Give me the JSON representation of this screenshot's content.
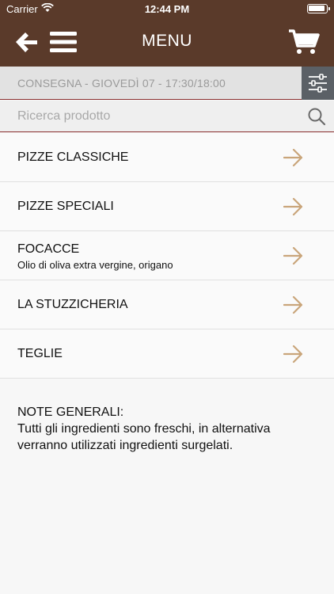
{
  "status_bar": {
    "carrier": "Carrier",
    "time": "12:44 PM"
  },
  "header": {
    "title": "MENU",
    "color": "#5a3a2a"
  },
  "delivery": {
    "text": "CONSEGNA - GIOVEDÌ 07 - 17:30/18:00"
  },
  "search": {
    "placeholder": "Ricerca prodotto",
    "value": ""
  },
  "categories": [
    {
      "label": "PIZZE CLASSICHE",
      "subtitle": ""
    },
    {
      "label": "PIZZE SPECIALI",
      "subtitle": ""
    },
    {
      "label": "FOCACCE",
      "subtitle": "Olio di oliva extra vergine, origano"
    },
    {
      "label": "LA STUZZICHERIA",
      "subtitle": ""
    },
    {
      "label": "TEGLIE",
      "subtitle": ""
    }
  ],
  "notes": {
    "title": "NOTE GENERALI:",
    "text": "Tutti gli ingredienti sono freschi, in alternativa verranno utilizzati ingredienti surgelati."
  },
  "icons": {
    "back": "back-arrow-icon",
    "menu": "hamburger-icon",
    "cart": "cart-icon",
    "filter": "sliders-icon",
    "search": "search-icon",
    "row_arrow": "arrow-right-icon"
  },
  "accent_color": "#c9a57a"
}
